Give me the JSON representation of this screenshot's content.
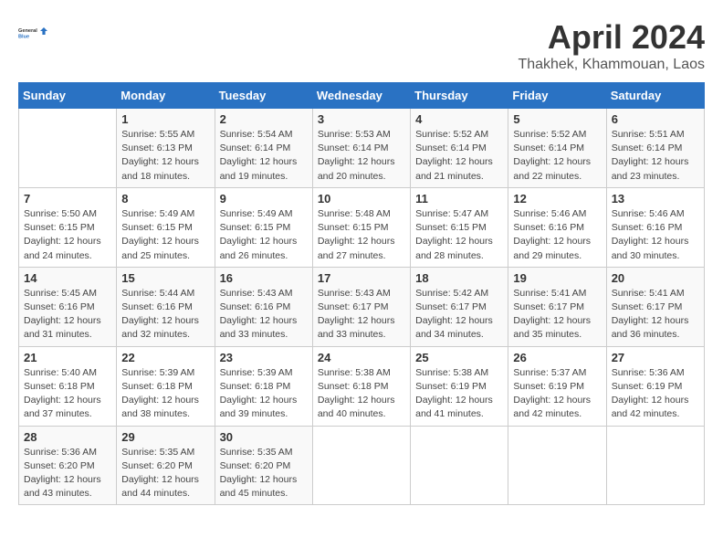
{
  "header": {
    "logo_line1": "General",
    "logo_line2": "Blue",
    "month": "April 2024",
    "location": "Thakhek, Khammouan, Laos"
  },
  "weekdays": [
    "Sunday",
    "Monday",
    "Tuesday",
    "Wednesday",
    "Thursday",
    "Friday",
    "Saturday"
  ],
  "weeks": [
    [
      {
        "day": "",
        "info": ""
      },
      {
        "day": "1",
        "info": "Sunrise: 5:55 AM\nSunset: 6:13 PM\nDaylight: 12 hours\nand 18 minutes."
      },
      {
        "day": "2",
        "info": "Sunrise: 5:54 AM\nSunset: 6:14 PM\nDaylight: 12 hours\nand 19 minutes."
      },
      {
        "day": "3",
        "info": "Sunrise: 5:53 AM\nSunset: 6:14 PM\nDaylight: 12 hours\nand 20 minutes."
      },
      {
        "day": "4",
        "info": "Sunrise: 5:52 AM\nSunset: 6:14 PM\nDaylight: 12 hours\nand 21 minutes."
      },
      {
        "day": "5",
        "info": "Sunrise: 5:52 AM\nSunset: 6:14 PM\nDaylight: 12 hours\nand 22 minutes."
      },
      {
        "day": "6",
        "info": "Sunrise: 5:51 AM\nSunset: 6:14 PM\nDaylight: 12 hours\nand 23 minutes."
      }
    ],
    [
      {
        "day": "7",
        "info": "Sunrise: 5:50 AM\nSunset: 6:15 PM\nDaylight: 12 hours\nand 24 minutes."
      },
      {
        "day": "8",
        "info": "Sunrise: 5:49 AM\nSunset: 6:15 PM\nDaylight: 12 hours\nand 25 minutes."
      },
      {
        "day": "9",
        "info": "Sunrise: 5:49 AM\nSunset: 6:15 PM\nDaylight: 12 hours\nand 26 minutes."
      },
      {
        "day": "10",
        "info": "Sunrise: 5:48 AM\nSunset: 6:15 PM\nDaylight: 12 hours\nand 27 minutes."
      },
      {
        "day": "11",
        "info": "Sunrise: 5:47 AM\nSunset: 6:15 PM\nDaylight: 12 hours\nand 28 minutes."
      },
      {
        "day": "12",
        "info": "Sunrise: 5:46 AM\nSunset: 6:16 PM\nDaylight: 12 hours\nand 29 minutes."
      },
      {
        "day": "13",
        "info": "Sunrise: 5:46 AM\nSunset: 6:16 PM\nDaylight: 12 hours\nand 30 minutes."
      }
    ],
    [
      {
        "day": "14",
        "info": "Sunrise: 5:45 AM\nSunset: 6:16 PM\nDaylight: 12 hours\nand 31 minutes."
      },
      {
        "day": "15",
        "info": "Sunrise: 5:44 AM\nSunset: 6:16 PM\nDaylight: 12 hours\nand 32 minutes."
      },
      {
        "day": "16",
        "info": "Sunrise: 5:43 AM\nSunset: 6:16 PM\nDaylight: 12 hours\nand 33 minutes."
      },
      {
        "day": "17",
        "info": "Sunrise: 5:43 AM\nSunset: 6:17 PM\nDaylight: 12 hours\nand 33 minutes."
      },
      {
        "day": "18",
        "info": "Sunrise: 5:42 AM\nSunset: 6:17 PM\nDaylight: 12 hours\nand 34 minutes."
      },
      {
        "day": "19",
        "info": "Sunrise: 5:41 AM\nSunset: 6:17 PM\nDaylight: 12 hours\nand 35 minutes."
      },
      {
        "day": "20",
        "info": "Sunrise: 5:41 AM\nSunset: 6:17 PM\nDaylight: 12 hours\nand 36 minutes."
      }
    ],
    [
      {
        "day": "21",
        "info": "Sunrise: 5:40 AM\nSunset: 6:18 PM\nDaylight: 12 hours\nand 37 minutes."
      },
      {
        "day": "22",
        "info": "Sunrise: 5:39 AM\nSunset: 6:18 PM\nDaylight: 12 hours\nand 38 minutes."
      },
      {
        "day": "23",
        "info": "Sunrise: 5:39 AM\nSunset: 6:18 PM\nDaylight: 12 hours\nand 39 minutes."
      },
      {
        "day": "24",
        "info": "Sunrise: 5:38 AM\nSunset: 6:18 PM\nDaylight: 12 hours\nand 40 minutes."
      },
      {
        "day": "25",
        "info": "Sunrise: 5:38 AM\nSunset: 6:19 PM\nDaylight: 12 hours\nand 41 minutes."
      },
      {
        "day": "26",
        "info": "Sunrise: 5:37 AM\nSunset: 6:19 PM\nDaylight: 12 hours\nand 42 minutes."
      },
      {
        "day": "27",
        "info": "Sunrise: 5:36 AM\nSunset: 6:19 PM\nDaylight: 12 hours\nand 42 minutes."
      }
    ],
    [
      {
        "day": "28",
        "info": "Sunrise: 5:36 AM\nSunset: 6:20 PM\nDaylight: 12 hours\nand 43 minutes."
      },
      {
        "day": "29",
        "info": "Sunrise: 5:35 AM\nSunset: 6:20 PM\nDaylight: 12 hours\nand 44 minutes."
      },
      {
        "day": "30",
        "info": "Sunrise: 5:35 AM\nSunset: 6:20 PM\nDaylight: 12 hours\nand 45 minutes."
      },
      {
        "day": "",
        "info": ""
      },
      {
        "day": "",
        "info": ""
      },
      {
        "day": "",
        "info": ""
      },
      {
        "day": "",
        "info": ""
      }
    ]
  ]
}
